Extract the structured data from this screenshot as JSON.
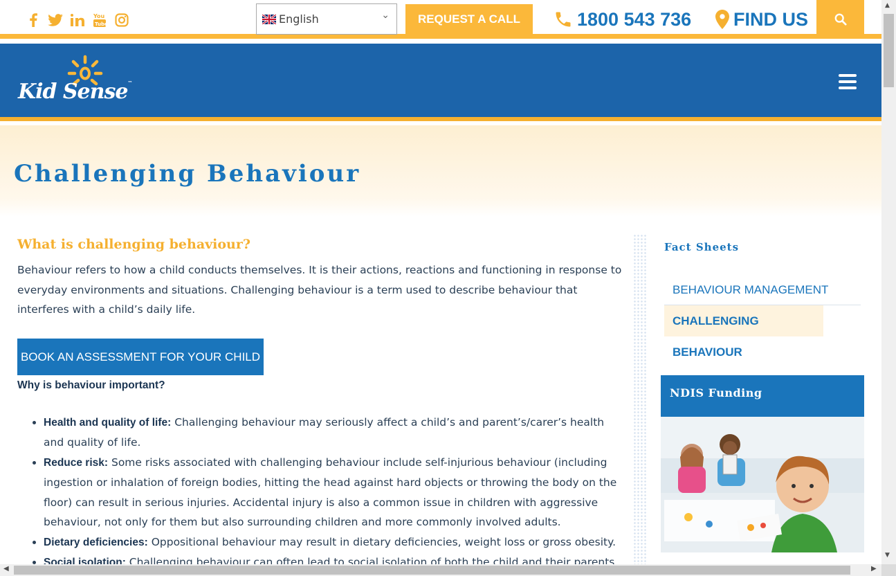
{
  "topbar": {
    "social": [
      {
        "icon": "facebook-icon",
        "glyph": "f"
      },
      {
        "icon": "twitter-icon",
        "glyph": "🐦"
      },
      {
        "icon": "linkedin-icon",
        "glyph": "in"
      },
      {
        "icon": "youtube-icon",
        "glyph": "You"
      },
      {
        "icon": "instagram-icon",
        "glyph": "◎"
      }
    ],
    "language": "English",
    "request_call": "REQUEST A CALL",
    "phone": "1800 543 736",
    "find_us": "FIND US"
  },
  "header": {
    "logo_text": "Kid Sense",
    "logo_tm": "™"
  },
  "page": {
    "title": "Challenging Behaviour"
  },
  "main": {
    "heading": "What is challenging behaviour?",
    "intro": "Behaviour refers to how a child conducts themselves. It is their actions, reactions and functioning in response to everyday environments and situations. Challenging behaviour is a term used to describe behaviour that interferes with a child’s daily life.",
    "book_button": "BOOK AN ASSESSMENT FOR YOUR CHILD",
    "why_heading": "Why is behaviour important?",
    "points": [
      {
        "term": "Health and quality of life:",
        "text": " Challenging behaviour may seriously affect a child’s and parent’s/carer’s health and quality of life."
      },
      {
        "term": "Reduce risk:",
        "text": " Some risks associated with challenging behaviour include self-injurious behaviour (including ingestion or inhalation of foreign bodies, hitting the head against hard objects or throwing the body on the floor) can result in serious injuries. Accidental injury is also a common issue in children with aggressive behaviour, not only for them but also surrounding children and more commonly involved adults."
      },
      {
        "term": "Dietary deficiencies:",
        "text": " Oppositional behaviour may result in dietary deficiencies, weight loss or gross obesity."
      },
      {
        "term": "Social isolation:",
        "text": " Challenging behaviour can often lead to social isolation of both the child and their parents."
      }
    ]
  },
  "sidebar": {
    "title": "Fact Sheets",
    "links": [
      "BEHAVIOUR MANAGEMENT",
      "CHALLENGING BEHAVIOUR"
    ],
    "ndis_title": "NDIS Funding"
  },
  "colors": {
    "brand_blue": "#1c64aa",
    "accent_yellow": "#fbb83a",
    "link_blue": "#1a75bb"
  }
}
